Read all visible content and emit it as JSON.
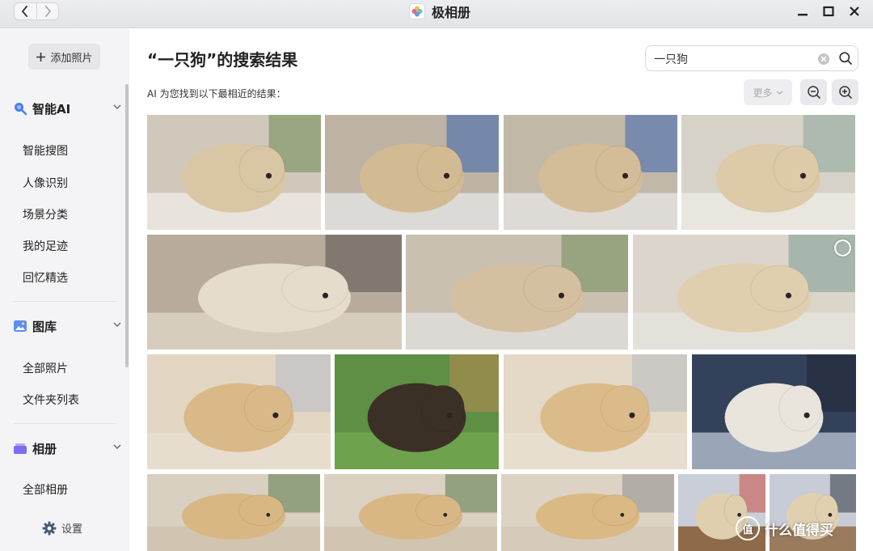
{
  "window": {
    "title": "极相册",
    "nav": {
      "back_icon": "chevron-left-icon",
      "forward_icon": "chevron-right-icon"
    },
    "controls": [
      "minimize-icon",
      "maximize-icon",
      "close-icon"
    ]
  },
  "sidebar": {
    "add_button": {
      "label": "添加照片",
      "icon": "plus-icon"
    },
    "sections": [
      {
        "label": "智能AI",
        "icon": "search-ai-icon",
        "items": [
          "智能搜图",
          "人像识别",
          "场景分类",
          "我的足迹",
          "回忆精选"
        ]
      },
      {
        "label": "图库",
        "icon": "image-icon",
        "items": [
          "全部照片",
          "文件夹列表"
        ]
      },
      {
        "label": "相册",
        "icon": "album-icon",
        "items": [
          "全部相册"
        ]
      }
    ],
    "settings": {
      "label": "设置",
      "icon": "gear-icon"
    }
  },
  "main": {
    "title": "“一只狗”的搜索结果",
    "subtitle": "AI 为您找到以下最相近的结果：",
    "search": {
      "value": "一只狗",
      "clear_icon": "clear-icon",
      "submit_icon": "search-icon"
    },
    "toolbar": {
      "more_label": "更多",
      "zoom_out_icon": "zoom-out-icon",
      "zoom_in_icon": "zoom-in-icon"
    }
  },
  "results": [
    {
      "name": "photo-dog-lying-blanket-1",
      "selected": false
    },
    {
      "name": "photo-dog-lying-blanket-2",
      "selected": false
    },
    {
      "name": "photo-dog-lying-blanket-3",
      "selected": false
    },
    {
      "name": "photo-dog-head-down-1",
      "selected": false
    },
    {
      "name": "photo-dog-on-sofa",
      "selected": false
    },
    {
      "name": "photo-dog-lying-side",
      "selected": false
    },
    {
      "name": "photo-dog-head-down-2",
      "selected": false
    },
    {
      "name": "photo-dog-profile-1",
      "selected": false
    },
    {
      "name": "photo-shepherd-on-grass",
      "selected": false
    },
    {
      "name": "photo-dog-profile-2",
      "selected": false
    },
    {
      "name": "photo-dog-on-floor",
      "selected": false
    },
    {
      "name": "photo-dog-portrait-1",
      "selected": false
    },
    {
      "name": "photo-dog-portrait-2",
      "selected": false
    },
    {
      "name": "photo-dog-profile-3",
      "selected": false
    },
    {
      "name": "photo-dog-yawning",
      "selected": false
    },
    {
      "name": "photo-dog-portrait-3",
      "selected": false
    }
  ],
  "watermark": {
    "text": "什么值得买",
    "logo_text": "值"
  },
  "colors": {
    "sidebar_bg": "#f4f4f6",
    "accent_blue": "#4a7cf5",
    "album_purple": "#7b6cf0"
  }
}
